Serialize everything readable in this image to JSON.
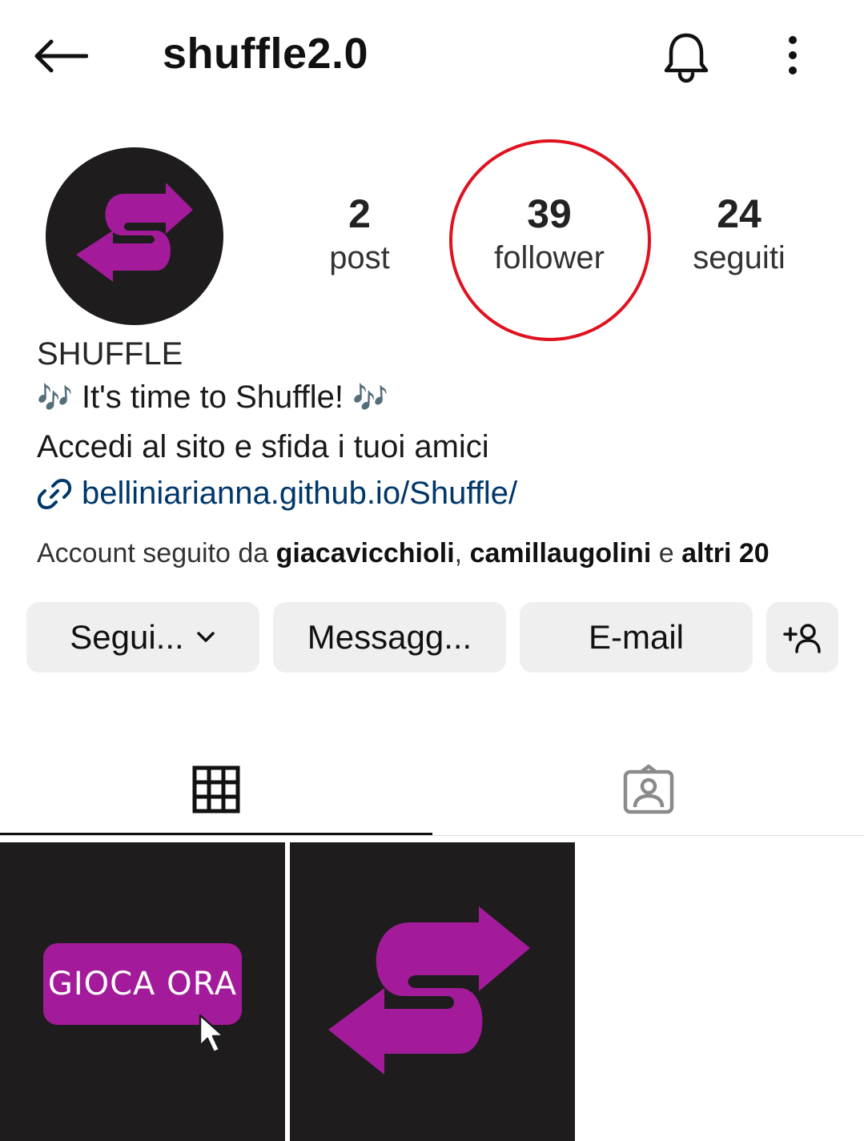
{
  "header": {
    "username": "shuffle2.0"
  },
  "stats": {
    "posts_count": "2",
    "posts_label": "post",
    "followers_count": "39",
    "followers_label": "follower",
    "following_count": "24",
    "following_label": "seguiti"
  },
  "bio": {
    "name": "SHUFFLE",
    "line1_text": " It's time to Shuffle! ",
    "music_emoji": "🎶",
    "line2": "Accedi al sito e sfida i tuoi amici",
    "link": "belliniarianna.github.io/Shuffle/",
    "followed_by_prefix": "Account seguito da ",
    "followed_by_user1": "giacavicchioli",
    "followed_by_sep": ", ",
    "followed_by_user2": "camillaugolini",
    "followed_by_and": " e ",
    "followed_by_more": "altri 20"
  },
  "actions": {
    "follow": "Segui...",
    "message": "Messagg...",
    "email": "E-mail",
    "add_user_icon": "add-person-icon"
  },
  "tabs": {
    "posts_icon": "grid-icon",
    "tagged_icon": "tagged-person-icon"
  },
  "posts": {
    "post1_button": "GIOCA ORA"
  },
  "colors": {
    "brand_purple": "#a31b9a",
    "dark_bg": "#1e1c1d",
    "highlight_ring": "#e0121f",
    "link_blue": "#00376b"
  }
}
